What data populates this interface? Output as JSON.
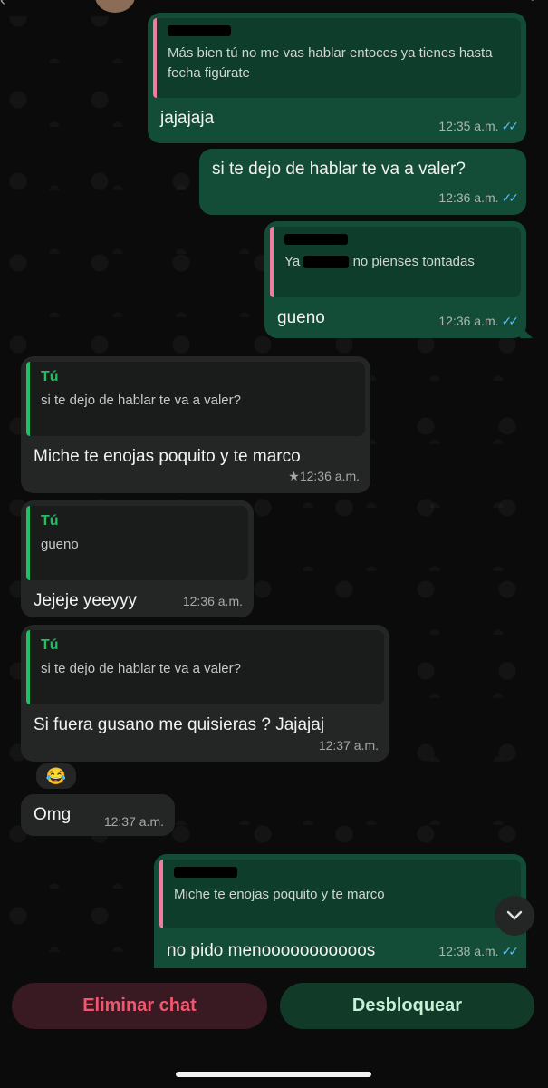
{
  "messages": [
    {
      "quote_text": "Más bien tú no me vas hablar entoces ya tienes hasta fecha figúrate",
      "text": "jajajaja",
      "time": "12:35 a.m."
    },
    {
      "text": "si te dejo de hablar te va a valer?",
      "time": "12:36 a.m."
    },
    {
      "quote_text_pre": "Ya",
      "quote_text_post": "no pienses tontadas",
      "text": "gueno",
      "time": "12:36 a.m."
    },
    {
      "quote_author": "Tú",
      "quote_text": "si te dejo de hablar te va a valer?",
      "text": "Miche te enojas poquito y te marco",
      "time": "12:36 a.m.",
      "star": "★"
    },
    {
      "quote_author": "Tú",
      "quote_text": "gueno",
      "text": "Jejeje yeeyyy",
      "time": "12:36 a.m."
    },
    {
      "quote_author": "Tú",
      "quote_text": "si te dejo de hablar te va a valer?",
      "text": "Si fuera gusano me quisieras ? Jajajaj",
      "time": "12:37 a.m.",
      "reaction": "😂"
    },
    {
      "text": "Omg",
      "time": "12:37 a.m."
    },
    {
      "quote_text": "Miche te enojas poquito y te marco",
      "text": "no pido menooooooooooos",
      "time": "12:38 a.m."
    }
  ],
  "read_ticks": "✓✓",
  "actions": {
    "delete_label": "Eliminar chat",
    "unblock_label": "Desbloquear"
  },
  "colors": {
    "outgoing": "#144d37",
    "incoming": "#242626",
    "delete_text": "#f0566e",
    "tick": "#53bdeb"
  }
}
